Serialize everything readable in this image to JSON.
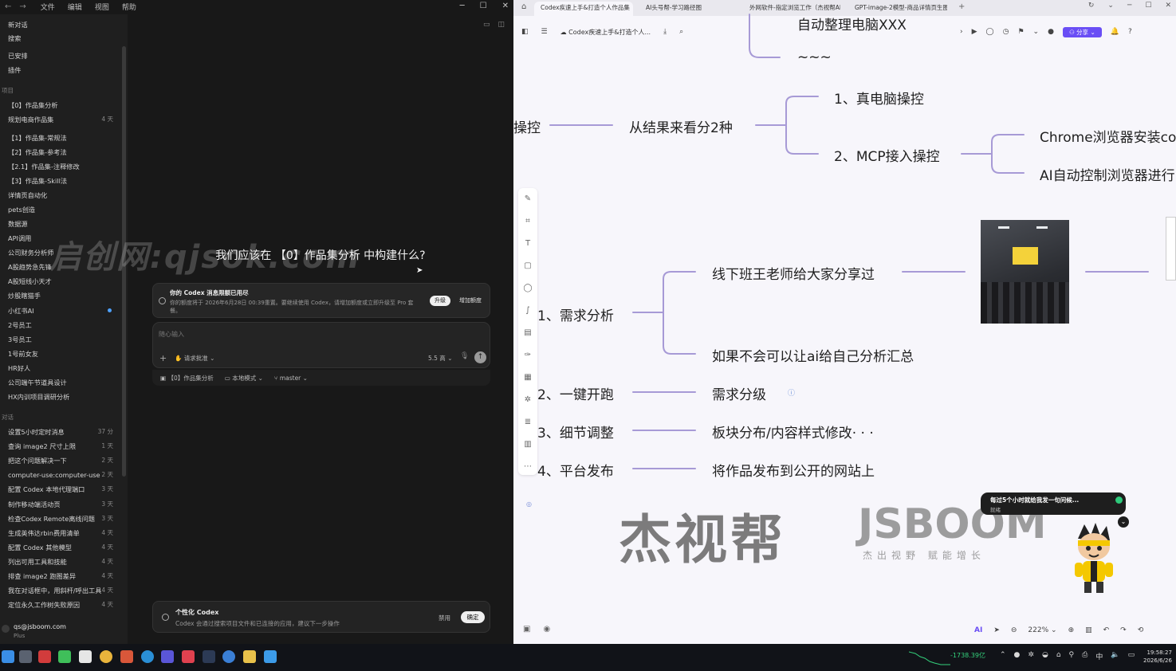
{
  "codex": {
    "menu": [
      "文件",
      "编辑",
      "视图",
      "帮助"
    ],
    "sidebar": {
      "top": [
        {
          "label": "新对话"
        },
        {
          "label": "搜索"
        },
        {
          "label": "已安排"
        },
        {
          "label": "插件"
        }
      ],
      "projects_heading": "项目",
      "projects": [
        {
          "label": "【0】作品集分析",
          "time": ""
        },
        {
          "label": "规划电商作品集",
          "time": "4 天"
        },
        {
          "label": "【1】作品集-常规法",
          "time": ""
        },
        {
          "label": "【2】作品集-参考法",
          "time": ""
        },
        {
          "label": "【2.1】作品集-注释修改",
          "time": ""
        },
        {
          "label": "【3】作品集-Skill法",
          "time": ""
        },
        {
          "label": "详情页自动化",
          "time": ""
        },
        {
          "label": "pets创造",
          "time": ""
        },
        {
          "label": "数据源",
          "time": ""
        },
        {
          "label": "API调用",
          "time": ""
        },
        {
          "label": "公司财务分析师",
          "time": ""
        },
        {
          "label": "A股趋势急先锋",
          "time": ""
        },
        {
          "label": "A股短线小天才",
          "time": ""
        },
        {
          "label": "炒股瞎猫手",
          "time": ""
        },
        {
          "label": "小红书AI",
          "time": ""
        },
        {
          "label": "2号员工",
          "time": ""
        },
        {
          "label": "3号员工",
          "time": ""
        },
        {
          "label": "1号前女友",
          "time": ""
        },
        {
          "label": "HR好人",
          "time": ""
        },
        {
          "label": "公司端午节道具设计",
          "time": ""
        },
        {
          "label": "HX内训项目调研分析",
          "time": ""
        }
      ],
      "chats_heading": "对话",
      "chats": [
        {
          "label": "设置5小时定时消息",
          "time": "37 分"
        },
        {
          "label": "查询 image2 尺寸上限",
          "time": "1 天"
        },
        {
          "label": "把这个问题解决一下",
          "time": "2 天"
        },
        {
          "label": "computer-use:computer-use 模...",
          "time": "2 天"
        },
        {
          "label": "配置 Codex 本地代理端口",
          "time": "3 天"
        },
        {
          "label": "制作移动端活动页",
          "time": "3 天"
        },
        {
          "label": "检查Codex Remote离线问题",
          "time": "3 天"
        },
        {
          "label": "生成英伟达rbin费用清单",
          "time": "4 天"
        },
        {
          "label": "配置 Codex 其他模型",
          "time": "4 天"
        },
        {
          "label": "列出可用工具和技能",
          "time": "4 天"
        },
        {
          "label": "排查 image2 跑图差异",
          "time": "4 天"
        },
        {
          "label": "我在对话框中，用斜杆/呼出工具...",
          "time": "4 天"
        },
        {
          "label": "定位永久工作树失败原因",
          "time": "4 天"
        }
      ],
      "user_email": "qs@jsboom.com",
      "user_plan": "Plus"
    },
    "watermark": "启创网:qjsok.com",
    "headline": "我们应该在 【0】作品集分析 中构建什么?",
    "notice": {
      "title": "你的 Codex 消息限额已用尽",
      "desc": "你的额度将于 2026年6月28日 00:39重置。要继续使用 Codex，请增加额度或立即升级至 Pro 套餐。",
      "upgrade": "升级",
      "add_quota": "增加额度"
    },
    "composer": {
      "placeholder": "随心输入",
      "mode": "请求批准",
      "model": "5.5 高"
    },
    "context": {
      "project": "【0】作品集分析",
      "local": "本地模式",
      "branch": "master"
    },
    "personal": {
      "title": "个性化 Codex",
      "desc": "Codex 会通过搜索项目文件和已连接的应用，建议下一步操作",
      "disable": "禁用",
      "confirm": "确定"
    }
  },
  "browser": {
    "tabs": [
      "Codex疾速上手&打造个人作品集",
      "AI头号帮-学习路径图",
      "外网软件-指定浏览工作（杰视帮AI头",
      "GPT-image-2模型-商品详情页生图技"
    ],
    "doc_title": "Codex疾速上手&打造个人...",
    "share": "分享",
    "zoom": "222%",
    "nodes": {
      "top1": "自动整理电脑XXX",
      "top2": "~~~",
      "ctrl": "操控",
      "result": "从结果来看分2种",
      "real": "1、真电脑操控",
      "mcp": "2、MCP接入操控",
      "chrome": "Chrome浏览器安装co",
      "ai_browser": "AI自动控制浏览器进行",
      "demand": "1、需求分析",
      "offline": "线下班王老师给大家分享过",
      "ai_sum": "如果不会可以让ai给自己分析汇总",
      "run": "2、一键开跑",
      "grade": "需求分级",
      "adjust": "3、细节调整",
      "layout": "板块分布/内容样式修改· · ·",
      "publish": "4、平台发布",
      "website": "将作品发布到公开的网站上"
    },
    "brand_cn": "杰视帮",
    "brand_en": "JSBOOM",
    "brand_sub": "杰出视野 赋能增长",
    "assistant_bubble": "每过5个小时就给我发一句问候...",
    "assistant_status": "就绪"
  },
  "taskbar": {
    "stock": "-1738.39亿",
    "ime": "中",
    "time": "19:58:27",
    "date": "2026/6/26"
  },
  "colors": {
    "mindmap_line": "#a79ad6",
    "share": "#6a4ef5",
    "stock": "#34d17c"
  }
}
